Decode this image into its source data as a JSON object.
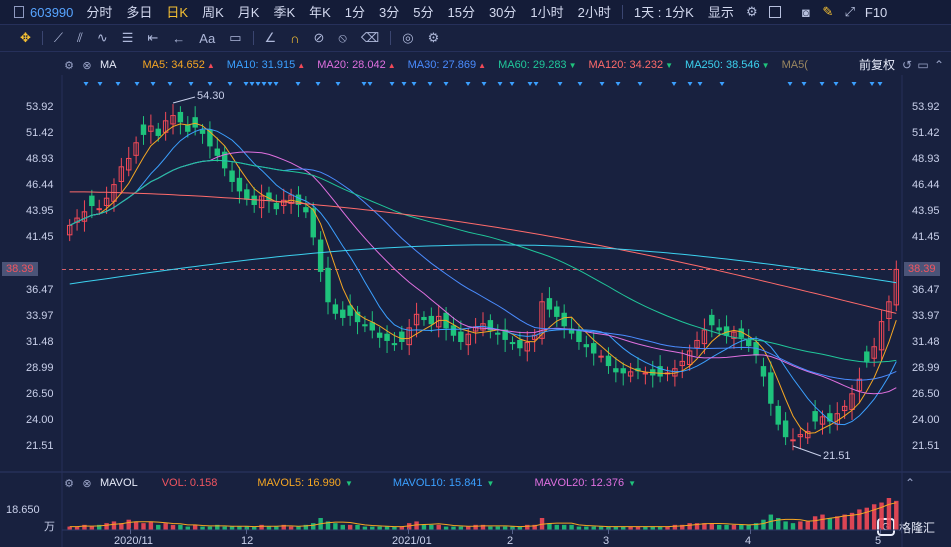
{
  "toolbar": {
    "stock_code": "603990",
    "periods": [
      "分时",
      "多日",
      "日K",
      "周K",
      "月K",
      "季K",
      "年K",
      "1分",
      "3分",
      "5分",
      "15分",
      "30分",
      "1小时",
      "2小时"
    ],
    "active_period": "日K",
    "combo_label": "1天 : 1分K",
    "display_label": "显示",
    "f10_label": "F10",
    "icons": [
      "gear-icon",
      "checkbox-icon",
      "camera-icon",
      "pen-icon",
      "expand-icon"
    ]
  },
  "draw_toolbar": {
    "icons": [
      "crosshair-icon",
      "line-tool-icon",
      "channel-tool-icon",
      "wave-tool-icon",
      "gann-tool-icon",
      "range-tool-icon",
      "arrow-tool-icon",
      "text-tool-icon",
      "note-tool-icon",
      "ruler-icon",
      "magnet-icon",
      "link-icon",
      "hide-icon",
      "trash-icon",
      "eye-icon",
      "settings-icon"
    ],
    "text_tool_label": "Aa"
  },
  "ma_legend": {
    "name": "MA",
    "items": [
      {
        "label": "MA5: 34.652",
        "dir": "up",
        "color": "#f5a623"
      },
      {
        "label": "MA10: 31.915",
        "dir": "up",
        "color": "#3ba0ff"
      },
      {
        "label": "MA20: 28.042",
        "dir": "up",
        "color": "#e070e0"
      },
      {
        "label": "MA30: 27.869",
        "dir": "up",
        "color": "#4a8cff"
      },
      {
        "label": "MA60: 29.283",
        "dir": "dn",
        "color": "#20c79a"
      },
      {
        "label": "MA120: 34.232",
        "dir": "dn",
        "color": "#ff6b6b"
      },
      {
        "label": "MA250: 38.546",
        "dir": "dn",
        "color": "#3cd2f0"
      },
      {
        "label": "MA5(",
        "dir": "",
        "color": "#9a8760"
      }
    ],
    "fuquan_label": "前复权"
  },
  "price_axis": {
    "ticks": [
      "53.92",
      "51.42",
      "48.93",
      "46.44",
      "43.95",
      "41.45",
      "38.39",
      "36.47",
      "33.97",
      "31.48",
      "28.99",
      "26.50",
      "24.00",
      "21.51"
    ],
    "current_price": "38.39",
    "high_label": "54.30",
    "low_label": "21.51"
  },
  "vol_legend": {
    "name": "MAVOL",
    "items": [
      {
        "label": "VOL: 0.158",
        "color": "#f25560",
        "dir": ""
      },
      {
        "label": "MAVOL5: 16.990",
        "color": "#f5a623",
        "dir": "dn"
      },
      {
        "label": "MAVOL10: 15.841",
        "color": "#3ba0ff",
        "dir": "dn"
      },
      {
        "label": "MAVOL20: 12.376",
        "color": "#e070e0",
        "dir": "dn"
      }
    ],
    "max_label": "18.650",
    "unit_label": "万"
  },
  "x_axis": {
    "labels": [
      "2020/11",
      "12",
      "2021/01",
      "2",
      "3",
      "4",
      "5"
    ]
  },
  "watermark": {
    "text": "格隆汇",
    "logo": "G"
  },
  "colors": {
    "up": "#f24957",
    "down": "#1fc37c",
    "background": "#18213f",
    "grid": "#26305a"
  },
  "chart_data": {
    "type": "candlestick",
    "title": "",
    "ylim": [
      21.51,
      53.92
    ],
    "y_ticks": [
      53.92,
      51.42,
      48.93,
      46.44,
      43.95,
      41.45,
      38.39,
      36.47,
      33.97,
      31.48,
      28.99,
      26.5,
      24.0,
      21.51
    ],
    "x_labels": [
      "2020/11",
      "12",
      "2021/01",
      "2",
      "3",
      "4",
      "5"
    ],
    "ohlc_closes": [
      42.6,
      43.3,
      43.9,
      44.5,
      44.2,
      45.2,
      46.5,
      48.2,
      49.0,
      50.5,
      51.3,
      52.1,
      51.2,
      52.6,
      53.1,
      52.5,
      51.6,
      52.0,
      51.4,
      50.2,
      49.3,
      48.1,
      46.8,
      45.9,
      45.1,
      44.6,
      45.4,
      45.0,
      44.2,
      45.0,
      45.5,
      44.6,
      43.9,
      41.5,
      38.2,
      35.3,
      34.2,
      33.8,
      34.0,
      33.4,
      33.0,
      32.6,
      31.9,
      31.6,
      31.2,
      31.5,
      32.8,
      34.1,
      33.6,
      33.2,
      33.9,
      32.8,
      32.1,
      31.5,
      32.2,
      32.9,
      33.2,
      32.6,
      32.2,
      31.7,
      31.3,
      30.9,
      31.4,
      32.1,
      35.3,
      34.6,
      33.9,
      33.0,
      32.3,
      31.5,
      31.0,
      30.4,
      30.1,
      29.2,
      28.6,
      28.5,
      28.6,
      28.7,
      28.5,
      28.3,
      28.2,
      28.5,
      28.9,
      29.6,
      30.6,
      31.6,
      32.6,
      33.1,
      32.6,
      32.1,
      32.4,
      31.9,
      31.1,
      30.2,
      28.2,
      25.6,
      23.6,
      22.4,
      22.1,
      22.6,
      22.9,
      23.9,
      24.3,
      23.9,
      24.6,
      25.3,
      26.5,
      27.9,
      29.6,
      31.0,
      33.4,
      35.3,
      38.39
    ],
    "ma_lines": [
      "MA5",
      "MA10",
      "MA20",
      "MA30",
      "MA60",
      "MA120",
      "MA250"
    ],
    "volume_max": 18.65,
    "volume_unit": "万",
    "volume": [
      2,
      2,
      3,
      2,
      3,
      4,
      5,
      4,
      6,
      5,
      4,
      5,
      3,
      4,
      3,
      3,
      2,
      3,
      2,
      2,
      3,
      2,
      2,
      2,
      2,
      2,
      3,
      2,
      2,
      3,
      2,
      2,
      3,
      4,
      7,
      5,
      4,
      3,
      3,
      3,
      2,
      2,
      2,
      2,
      2,
      2,
      4,
      5,
      3,
      3,
      3,
      2,
      2,
      2,
      2,
      3,
      3,
      2,
      2,
      2,
      2,
      2,
      3,
      3,
      7,
      4,
      3,
      3,
      3,
      2,
      2,
      2,
      2,
      2,
      2,
      2,
      2,
      2,
      2,
      2,
      2,
      2,
      3,
      3,
      4,
      4,
      4,
      4,
      3,
      3,
      3,
      3,
      3,
      4,
      6,
      9,
      7,
      5,
      4,
      5,
      5,
      8,
      9,
      7,
      8,
      9,
      10,
      12,
      13,
      15,
      16,
      18.65,
      17
    ]
  }
}
